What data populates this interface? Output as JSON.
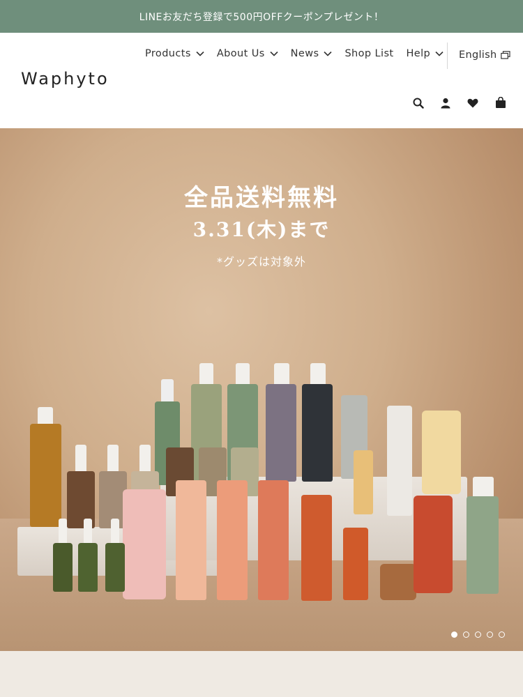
{
  "announcement": {
    "text": "LINEお友だち登録で500円OFFクーポンプレゼント！"
  },
  "brand": {
    "name": "Waphyto"
  },
  "nav": {
    "items": [
      {
        "label": "Products",
        "has_dropdown": true
      },
      {
        "label": "About Us",
        "has_dropdown": true
      },
      {
        "label": "News",
        "has_dropdown": true
      },
      {
        "label": "Shop List",
        "has_dropdown": false
      },
      {
        "label": "Help",
        "has_dropdown": true
      }
    ],
    "language": "English"
  },
  "header_icons": [
    "search-icon",
    "account-icon",
    "heart-icon",
    "cart-icon"
  ],
  "hero": {
    "headline": "全品送料無料",
    "date_line": "3.31(木)まで",
    "note": "*グッズは対象外",
    "slides_total": 5,
    "active_slide": 1
  },
  "colors": {
    "announcement_bg": "#6f8f7c",
    "header_bg": "#ffffff",
    "page_bg": "#efeae3"
  }
}
